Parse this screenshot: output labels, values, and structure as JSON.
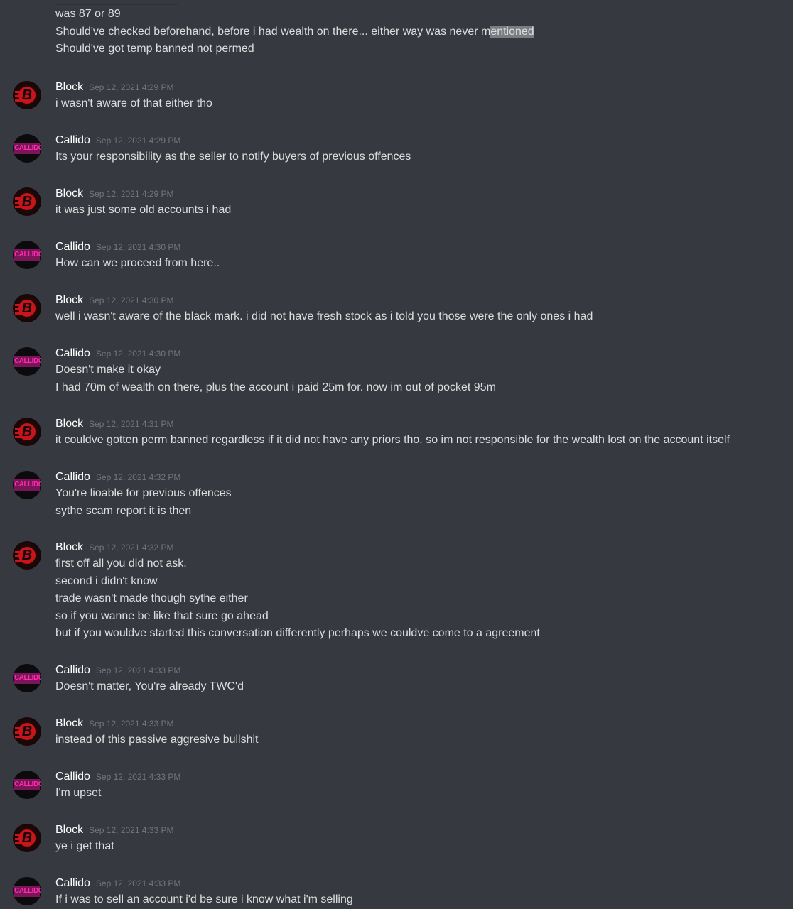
{
  "top_continuation": {
    "lines": [
      "was 87 or 89",
      "Should've checked beforehand, before i had wealth on there... either way was never m",
      "Should've got temp banned not permed"
    ],
    "selected_fragment": "entioned"
  },
  "messages": [
    {
      "author": "Block",
      "timestamp": "Sep 12, 2021 4:29 PM",
      "lines": [
        "i wasn't aware of that either tho"
      ]
    },
    {
      "author": "Callido",
      "timestamp": "Sep 12, 2021 4:29 PM",
      "lines": [
        "Its your responsibility as the seller to notify buyers of previous offences"
      ]
    },
    {
      "author": "Block",
      "timestamp": "Sep 12, 2021 4:29 PM",
      "lines": [
        "it was just some old accounts i had"
      ]
    },
    {
      "author": "Callido",
      "timestamp": "Sep 12, 2021 4:30 PM",
      "lines": [
        "How can we proceed from here.."
      ]
    },
    {
      "author": "Block",
      "timestamp": "Sep 12, 2021 4:30 PM",
      "lines": [
        "well i wasn't aware of the black mark. i did not have fresh stock as i told you those were the only ones i had"
      ]
    },
    {
      "author": "Callido",
      "timestamp": "Sep 12, 2021 4:30 PM",
      "lines": [
        "Doesn't make it okay",
        "I had 70m of wealth on there, plus the account i paid 25m for. now im out of pocket 95m"
      ]
    },
    {
      "author": "Block",
      "timestamp": "Sep 12, 2021 4:31 PM",
      "lines": [
        "it couldve gotten perm banned regardless if it did not have any priors tho. so im not responsible for the wealth lost on the account itself"
      ]
    },
    {
      "author": "Callido",
      "timestamp": "Sep 12, 2021 4:32 PM",
      "lines": [
        "You're lioable for previous offences",
        "sythe scam report it is then"
      ]
    },
    {
      "author": "Block",
      "timestamp": "Sep 12, 2021 4:32 PM",
      "lines": [
        "first off all you did not ask.",
        "second i didn't know",
        "trade wasn't made though sythe either",
        "so if you wanne be like that sure go ahead",
        "but if you wouldve started this conversation differently perhaps we couldve come to a agreement"
      ]
    },
    {
      "author": "Callido",
      "timestamp": "Sep 12, 2021 4:33 PM",
      "lines": [
        "Doesn't matter, You're already TWC'd"
      ]
    },
    {
      "author": "Block",
      "timestamp": "Sep 12, 2021 4:33 PM",
      "lines": [
        "instead of this passive aggresive bullshit"
      ]
    },
    {
      "author": "Callido",
      "timestamp": "Sep 12, 2021 4:33 PM",
      "lines": [
        "I'm upset"
      ]
    },
    {
      "author": "Block",
      "timestamp": "Sep 12, 2021 4:33 PM",
      "lines": [
        "ye i get that"
      ]
    },
    {
      "author": "Callido",
      "timestamp": "Sep 12, 2021 4:33 PM",
      "lines": [
        "If i was to sell an account i'd be sure i know what i'm selling"
      ]
    }
  ],
  "avatars": {
    "block": {
      "letter": "B",
      "color": "#c8141a",
      "icon": "block-avatar-icon"
    },
    "callido": {
      "label": "CALLIDO",
      "color": "#ff2bb0",
      "icon": "callido-avatar-icon"
    }
  },
  "colors": {
    "background": "#36393f",
    "text": "#dcddde",
    "author": "#ffffff",
    "timestamp": "#72767d"
  }
}
